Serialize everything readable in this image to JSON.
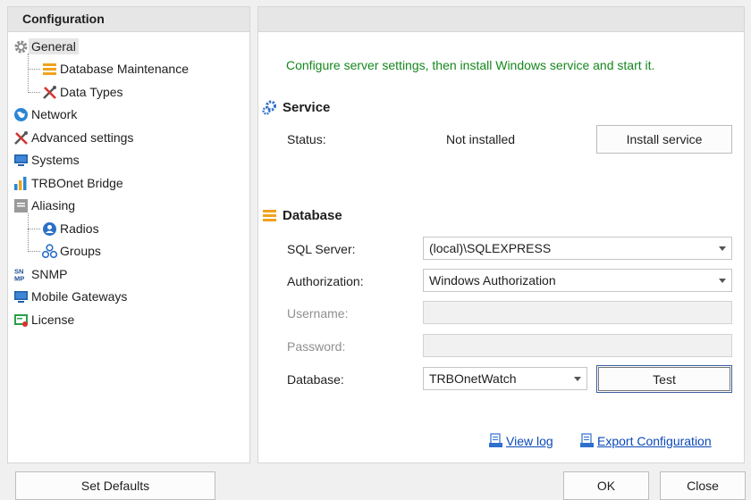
{
  "sidebar": {
    "header": "Configuration",
    "items": [
      {
        "label": "General",
        "icon": "gear-icon"
      },
      {
        "label": "Database Maintenance",
        "icon": "database-icon"
      },
      {
        "label": "Data Types",
        "icon": "tools-icon"
      },
      {
        "label": "Network",
        "icon": "globe-icon"
      },
      {
        "label": "Advanced settings",
        "icon": "tools-icon"
      },
      {
        "label": "Systems",
        "icon": "monitor-icon"
      },
      {
        "label": "TRBOnet Bridge",
        "icon": "bars-icon"
      },
      {
        "label": "Aliasing",
        "icon": "list-icon"
      },
      {
        "label": "Radios",
        "icon": "user-icon"
      },
      {
        "label": "Groups",
        "icon": "group-icon"
      },
      {
        "label": "SNMP",
        "icon": "snmp-icon"
      },
      {
        "label": "Mobile Gateways",
        "icon": "monitor-icon"
      },
      {
        "label": "License",
        "icon": "license-icon"
      }
    ]
  },
  "main": {
    "hint": "Configure server settings, then install Windows service and start it.",
    "service": {
      "title": "Service",
      "status_label": "Status:",
      "status_value": "Not installed",
      "install_button": "Install service"
    },
    "database": {
      "title": "Database",
      "sql_server_label": "SQL Server:",
      "sql_server_value": "(local)\\SQLEXPRESS",
      "authorization_label": "Authorization:",
      "authorization_value": "Windows Authorization",
      "username_label": "Username:",
      "password_label": "Password:",
      "database_label": "Database:",
      "database_value": "TRBOnetWatch",
      "test_button": "Test"
    },
    "links": {
      "view_log": "View log",
      "export_configuration": "Export Configuration"
    }
  },
  "footer": {
    "set_defaults": "Set Defaults",
    "ok": "OK",
    "close": "Close"
  },
  "colors": {
    "hint_text": "#14871c",
    "link": "#0b49b8",
    "database_icon": "#f0a21e",
    "service_icon": "#2f6fce"
  }
}
